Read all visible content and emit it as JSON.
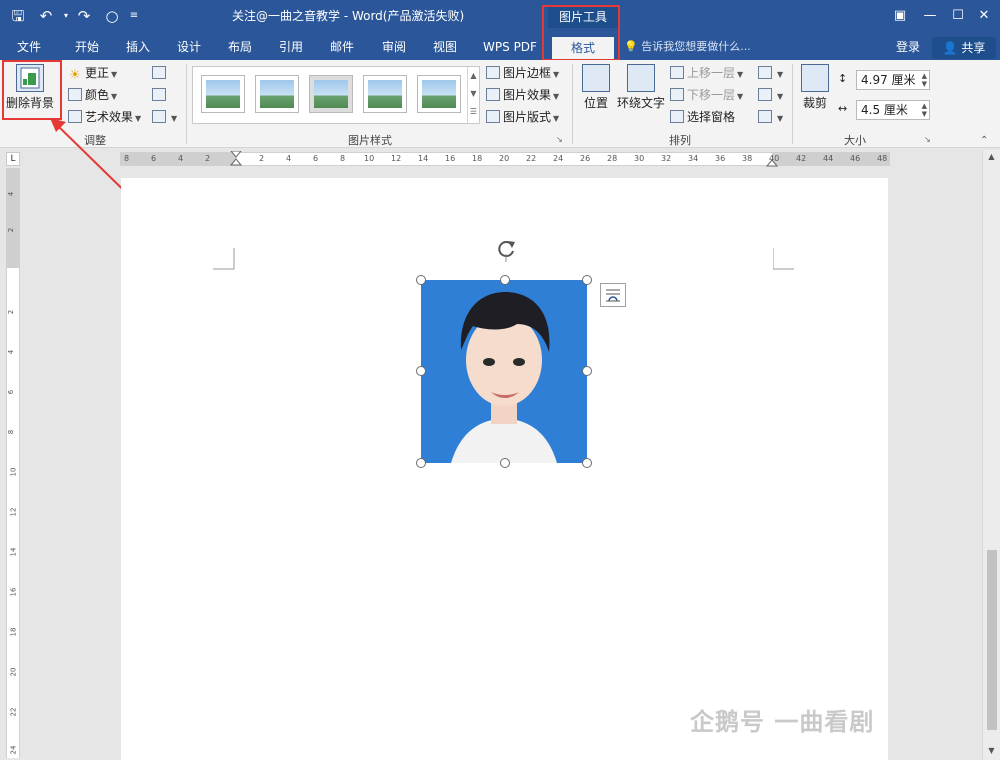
{
  "titlebar": {
    "title": "关注@一曲之音教学 - Word(产品激活失败)",
    "contextual_tab_group": "图片工具",
    "quick_access": {
      "save_icon": "save-icon",
      "undo_icon": "undo-icon",
      "redo_icon": "redo-icon",
      "touch_icon": "touch-mode-icon"
    }
  },
  "tabs": [
    "文件",
    "开始",
    "插入",
    "设计",
    "布局",
    "引用",
    "邮件",
    "审阅",
    "视图",
    "WPS PDF",
    "格式"
  ],
  "active_tab": "格式",
  "tell_me": "告诉我您想要做什么...",
  "account": {
    "signin": "登录",
    "share": "共享"
  },
  "ribbon": {
    "adjust": {
      "label": "调整",
      "remove_background": "删除背景",
      "corrections": "更正",
      "color": "颜色",
      "artistic_effects": "艺术效果"
    },
    "picture_styles": {
      "label": "图片样式",
      "border": "图片边框",
      "effects": "图片效果",
      "layout": "图片版式"
    },
    "arrange": {
      "label": "排列",
      "position": "位置",
      "wrap_text": "环绕文字",
      "bring_forward": "上移一层",
      "send_backward": "下移一层",
      "selection_pane": "选择窗格"
    },
    "size": {
      "label": "大小",
      "crop": "裁剪",
      "height": "4.97 厘米",
      "width": "4.5 厘米"
    }
  },
  "ruler_h_ticks": [
    "8",
    "6",
    "4",
    "2",
    "2",
    "4",
    "6",
    "8",
    "10",
    "12",
    "14",
    "16",
    "18",
    "20",
    "22",
    "24",
    "26",
    "28",
    "30",
    "32",
    "34",
    "36",
    "38",
    "40",
    "42",
    "44",
    "46",
    "48"
  ],
  "ruler_v_ticks": [
    "4",
    "2",
    "2",
    "4",
    "6",
    "8",
    "10",
    "12",
    "14",
    "16",
    "18",
    "20",
    "22",
    "24"
  ],
  "watermark": "企鹅号 一曲看剧",
  "colors": {
    "accent": "#2b579a",
    "highlight": "#e53935",
    "photo_bg": "#2f7fd6"
  }
}
